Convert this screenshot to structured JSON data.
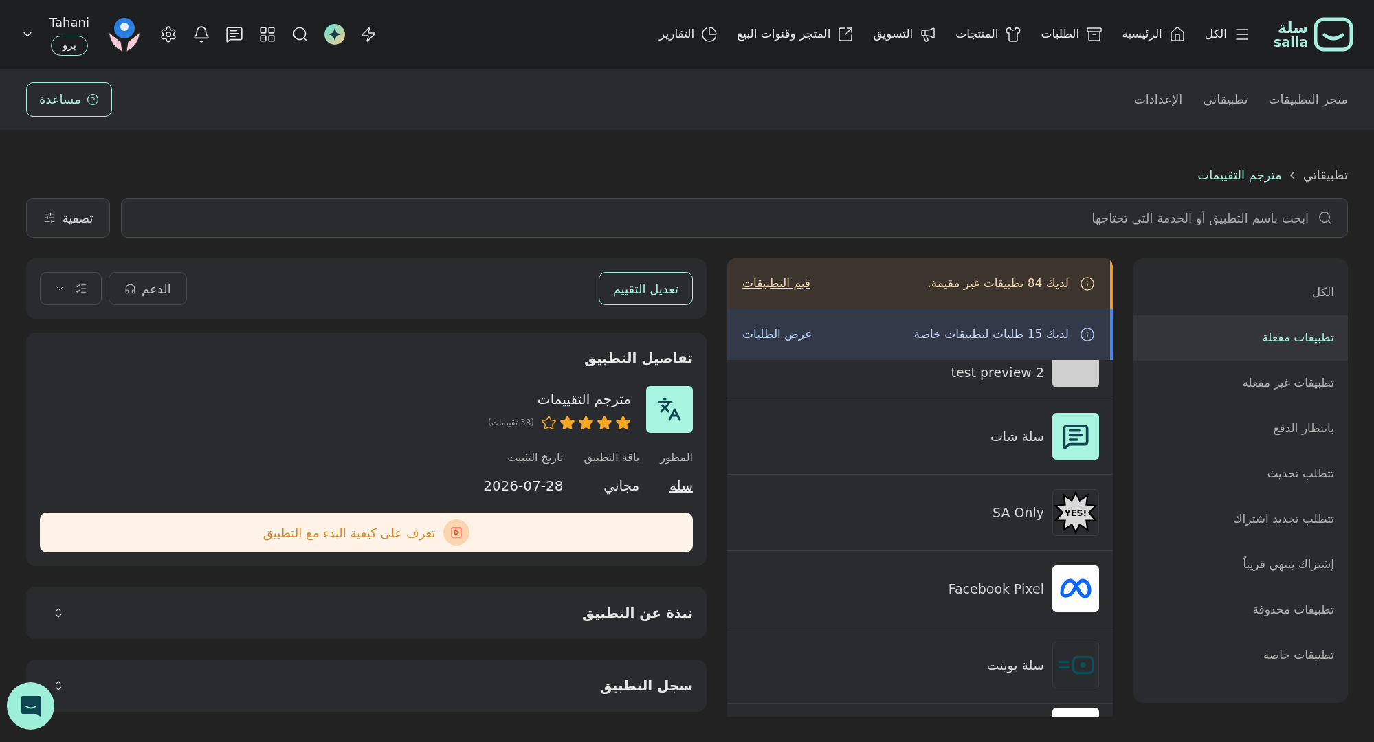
{
  "top_nav": {
    "logo": {
      "arabic": "سلة",
      "latin": "salla"
    },
    "items": [
      {
        "label": "الكل"
      },
      {
        "label": "الرئيسية"
      },
      {
        "label": "الطلبات"
      },
      {
        "label": "المنتجات"
      },
      {
        "label": "التسويق"
      },
      {
        "label": "المتجر وقنوات البيع"
      },
      {
        "label": "التقارير"
      }
    ],
    "user": {
      "name": "Tahani",
      "plan": "برو"
    }
  },
  "sub_nav": {
    "links": [
      "متجر التطبيقات",
      "تطبيقاتي",
      "الإعدادات"
    ],
    "help_button": "مساعدة"
  },
  "breadcrumb": [
    "تطبيقاتي",
    "مترجم التقييمات"
  ],
  "search": {
    "placeholder": "ابحث باسم التطبيق أو الخدمة التي تحتاجها"
  },
  "filter_button": "تصفية",
  "sidebar": {
    "items": [
      {
        "label": "الكل",
        "selected": false
      },
      {
        "label": "تطبيقات مفعلة",
        "selected": true
      },
      {
        "label": "تطبيقات غير مفعلة",
        "selected": false
      },
      {
        "label": "بانتظار الدفع",
        "selected": false
      },
      {
        "label": "تتطلب تحديث",
        "selected": false
      },
      {
        "label": "تتطلب تجديد اشتراك",
        "selected": false
      },
      {
        "label": "إشتراك ينتهي قريباً",
        "selected": false
      },
      {
        "label": "تطبيقات محذوفة",
        "selected": false
      },
      {
        "label": "تطبيقات خاصة",
        "selected": false
      }
    ]
  },
  "notices": [
    {
      "kind": "warning",
      "text": "لديك 84 تطبيقات غير مقيمة.",
      "link": "قيم التطبيقات"
    },
    {
      "kind": "info",
      "text": "لديك 15 طلبات لتطبيقات خاصة",
      "link": "عرض الطلبات"
    }
  ],
  "apps": [
    {
      "kind": "placeholder",
      "name": "test preview 2"
    },
    {
      "kind": "chat",
      "name": "سلة شات"
    },
    {
      "kind": "yes",
      "name": "SA Only",
      "icon_text": "YES!"
    },
    {
      "kind": "meta",
      "name": "Facebook Pixel"
    },
    {
      "kind": "point",
      "name": "سلة بوينت"
    },
    {
      "kind": "blank"
    }
  ],
  "actions": {
    "edit_rating": "تعديل التقييم",
    "support": "الدعم"
  },
  "details": {
    "title": "تفاصيل التطبيق",
    "app_name": "مترجم التقييمات",
    "stars": 4,
    "rating_count": "(38 تقييمات)",
    "fields": [
      {
        "label": "المطور",
        "value": "سلة",
        "link": true
      },
      {
        "label": "باقة التطبيق",
        "value": "مجاني",
        "link": false
      },
      {
        "label": "تاريخ التثبيت",
        "value": "2026-07-28",
        "link": false
      }
    ],
    "guide": "تعرف على كيفية البدء مع التطبيق"
  },
  "sections": [
    {
      "title": "نبذة عن التطبيق"
    },
    {
      "title": "سجل التطبيق"
    }
  ]
}
